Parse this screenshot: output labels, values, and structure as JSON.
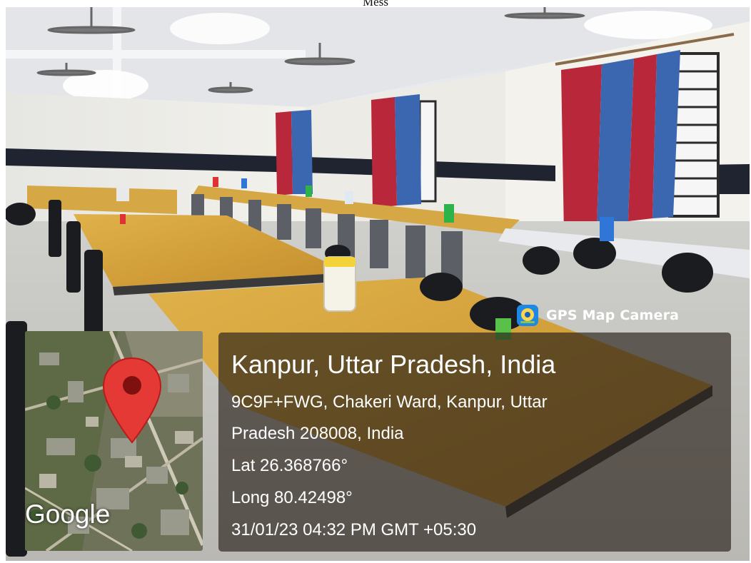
{
  "caption": "Mess",
  "badge": {
    "label": "GPS Map Camera",
    "icon": "gps-map-camera-icon"
  },
  "location": {
    "title": "Kanpur, Uttar Pradesh, India",
    "address_line1": "9C9F+FWG, Chakeri Ward, Kanpur, Uttar",
    "address_line2": "Pradesh 208008, India",
    "latitude": "Lat 26.368766°",
    "longitude": "Long 80.42498°",
    "timestamp": "31/01/23 04:32 PM GMT +05:30"
  },
  "map": {
    "attribution": "Google",
    "marker_icon": "map-pin-icon",
    "marker_color": "#e53935"
  },
  "colors": {
    "panel_overlay": "#28201899",
    "curtain_red": "#b8283a",
    "curtain_blue": "#3b66b0",
    "table_top": "#d9a441"
  }
}
